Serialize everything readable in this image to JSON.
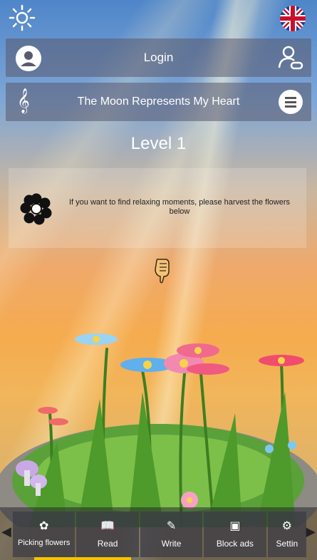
{
  "header": {
    "sun_icon": "sun-icon",
    "flag_icon": "uk-flag-icon"
  },
  "login_bar": {
    "label": "Login",
    "avatar_icon": "user-avatar-icon",
    "link_icon": "user-link-icon"
  },
  "song_bar": {
    "title": "The Moon Represents My Heart",
    "clef_icon": "treble-clef-icon",
    "menu_icon": "hamburger-menu-icon"
  },
  "level": {
    "label": "Level 1"
  },
  "quest": {
    "text": "If you want to find relaxing moments, please harvest the flowers below",
    "icon": "flower-icon"
  },
  "bottom_nav": {
    "tabs": [
      {
        "label": "Picking flowers",
        "icon": "flower-outline-icon"
      },
      {
        "label": "Read",
        "icon": "open-book-icon"
      },
      {
        "label": "Write",
        "icon": "pen-icon"
      },
      {
        "label": "Block ads",
        "icon": "ad-block-icon"
      },
      {
        "label": "Settin",
        "icon": "gear-icon"
      }
    ],
    "progress": 0.33
  },
  "colors": {
    "accent": "#f5c400",
    "panel": "#5a5a6e"
  }
}
